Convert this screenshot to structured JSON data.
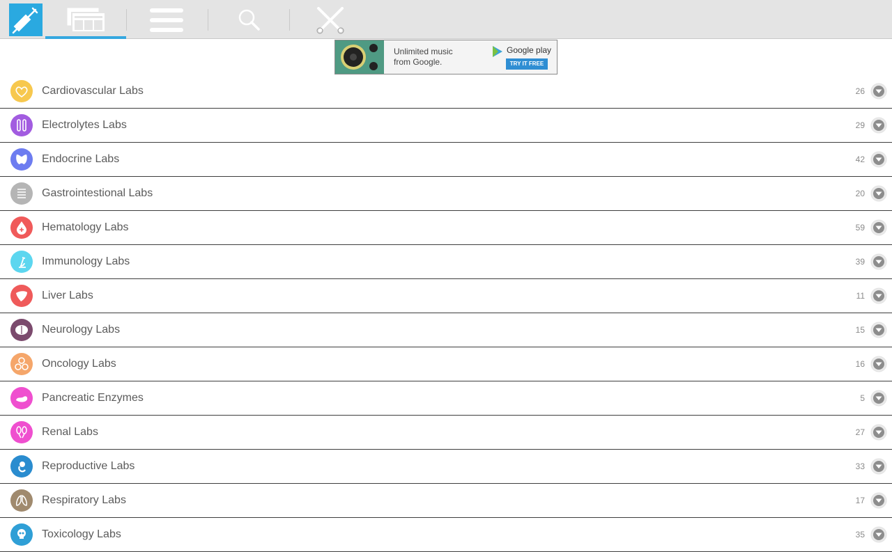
{
  "toolbar": {
    "tabs": [
      {
        "icon": "syringe-icon"
      },
      {
        "icon": "news-cards-icon",
        "active": true
      },
      {
        "icon": "menu-lines-icon"
      },
      {
        "icon": "search-icon"
      },
      {
        "icon": "tools-icon"
      }
    ],
    "colors": {
      "background": "#e4e4e4",
      "accent": "#2aa9e0"
    }
  },
  "ad": {
    "text_line1": "Unlimited music",
    "text_line2": "from Google.",
    "brand": "Google play",
    "cta": "TRY IT FREE"
  },
  "categories": [
    {
      "label": "Cardiovascular Labs",
      "count": "26",
      "color": "#f7c84e",
      "icon": "heart-icon"
    },
    {
      "label": "Electrolytes Labs",
      "count": "29",
      "color": "#a25ce0",
      "icon": "test-tubes-icon"
    },
    {
      "label": "Endocrine Labs",
      "count": "42",
      "color": "#6d7cf0",
      "icon": "thyroid-icon"
    },
    {
      "label": "Gastrointestional Labs",
      "count": "20",
      "color": "#b5b5b5",
      "icon": "intestine-icon"
    },
    {
      "label": "Hematology Labs",
      "count": "59",
      "color": "#f05a5a",
      "icon": "blood-drop-icon"
    },
    {
      "label": "Immunology Labs",
      "count": "39",
      "color": "#5cd6ef",
      "icon": "microscope-icon"
    },
    {
      "label": "Liver Labs",
      "count": "11",
      "color": "#ef5a5a",
      "icon": "liver-icon"
    },
    {
      "label": "Neurology Labs",
      "count": "15",
      "color": "#7b4a6d",
      "icon": "brain-icon"
    },
    {
      "label": "Oncology Labs",
      "count": "16",
      "color": "#f5a66a",
      "icon": "cells-icon"
    },
    {
      "label": "Pancreatic Enzymes",
      "count": "5",
      "color": "#ef4fcf",
      "icon": "pancreas-icon"
    },
    {
      "label": "Renal Labs",
      "count": "27",
      "color": "#ef4fcf",
      "icon": "kidney-icon"
    },
    {
      "label": "Reproductive Labs",
      "count": "33",
      "color": "#2a8ccf",
      "icon": "fetus-icon"
    },
    {
      "label": "Respiratory Labs",
      "count": "17",
      "color": "#a08a6e",
      "icon": "lungs-icon"
    },
    {
      "label": "Toxicology Labs",
      "count": "35",
      "color": "#2f9fd6",
      "icon": "skull-icon"
    }
  ]
}
